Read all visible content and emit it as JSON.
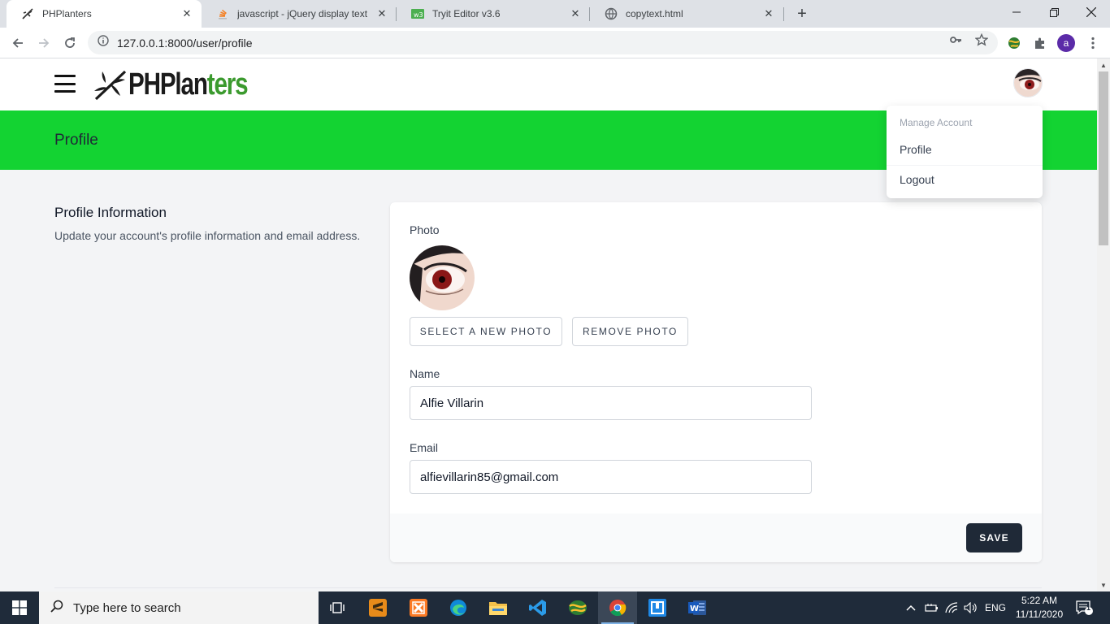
{
  "browser": {
    "tabs": [
      {
        "title": "PHPlanters",
        "icon": "dragonfly-icon",
        "active": true
      },
      {
        "title": "javascript - jQuery display text in",
        "icon": "stackoverflow-icon",
        "active": false
      },
      {
        "title": "Tryit Editor v3.6",
        "icon": "w3schools-icon",
        "active": false
      },
      {
        "title": "copytext.html",
        "icon": "globe-icon",
        "active": false
      }
    ],
    "url": "127.0.0.1:8000/user/profile",
    "profile_initial": "a"
  },
  "app": {
    "logo_dark": "PHPlan",
    "logo_green": "ters",
    "header_title": "Profile",
    "section_title": "Profile Information",
    "section_description": "Update your account's profile information and email address.",
    "photo_label": "Photo",
    "select_photo_button": "SELECT A NEW PHOTO",
    "remove_photo_button": "REMOVE PHOTO",
    "name_label": "Name",
    "name_value": "Alfie Villarin",
    "email_label": "Email",
    "email_value": "alfievillarin85@gmail.com",
    "save_button": "SAVE",
    "dropdown": {
      "header": "Manage Account",
      "items": [
        "Profile",
        "Logout"
      ]
    },
    "colors": {
      "header_green": "#13d332",
      "logo_green": "#3b9a2e",
      "save_button_bg": "#1f2937"
    }
  },
  "taskbar": {
    "search_placeholder": "Type here to search",
    "language": "ENG",
    "time": "5:22 AM",
    "date": "11/11/2020",
    "notification_count": "1"
  }
}
